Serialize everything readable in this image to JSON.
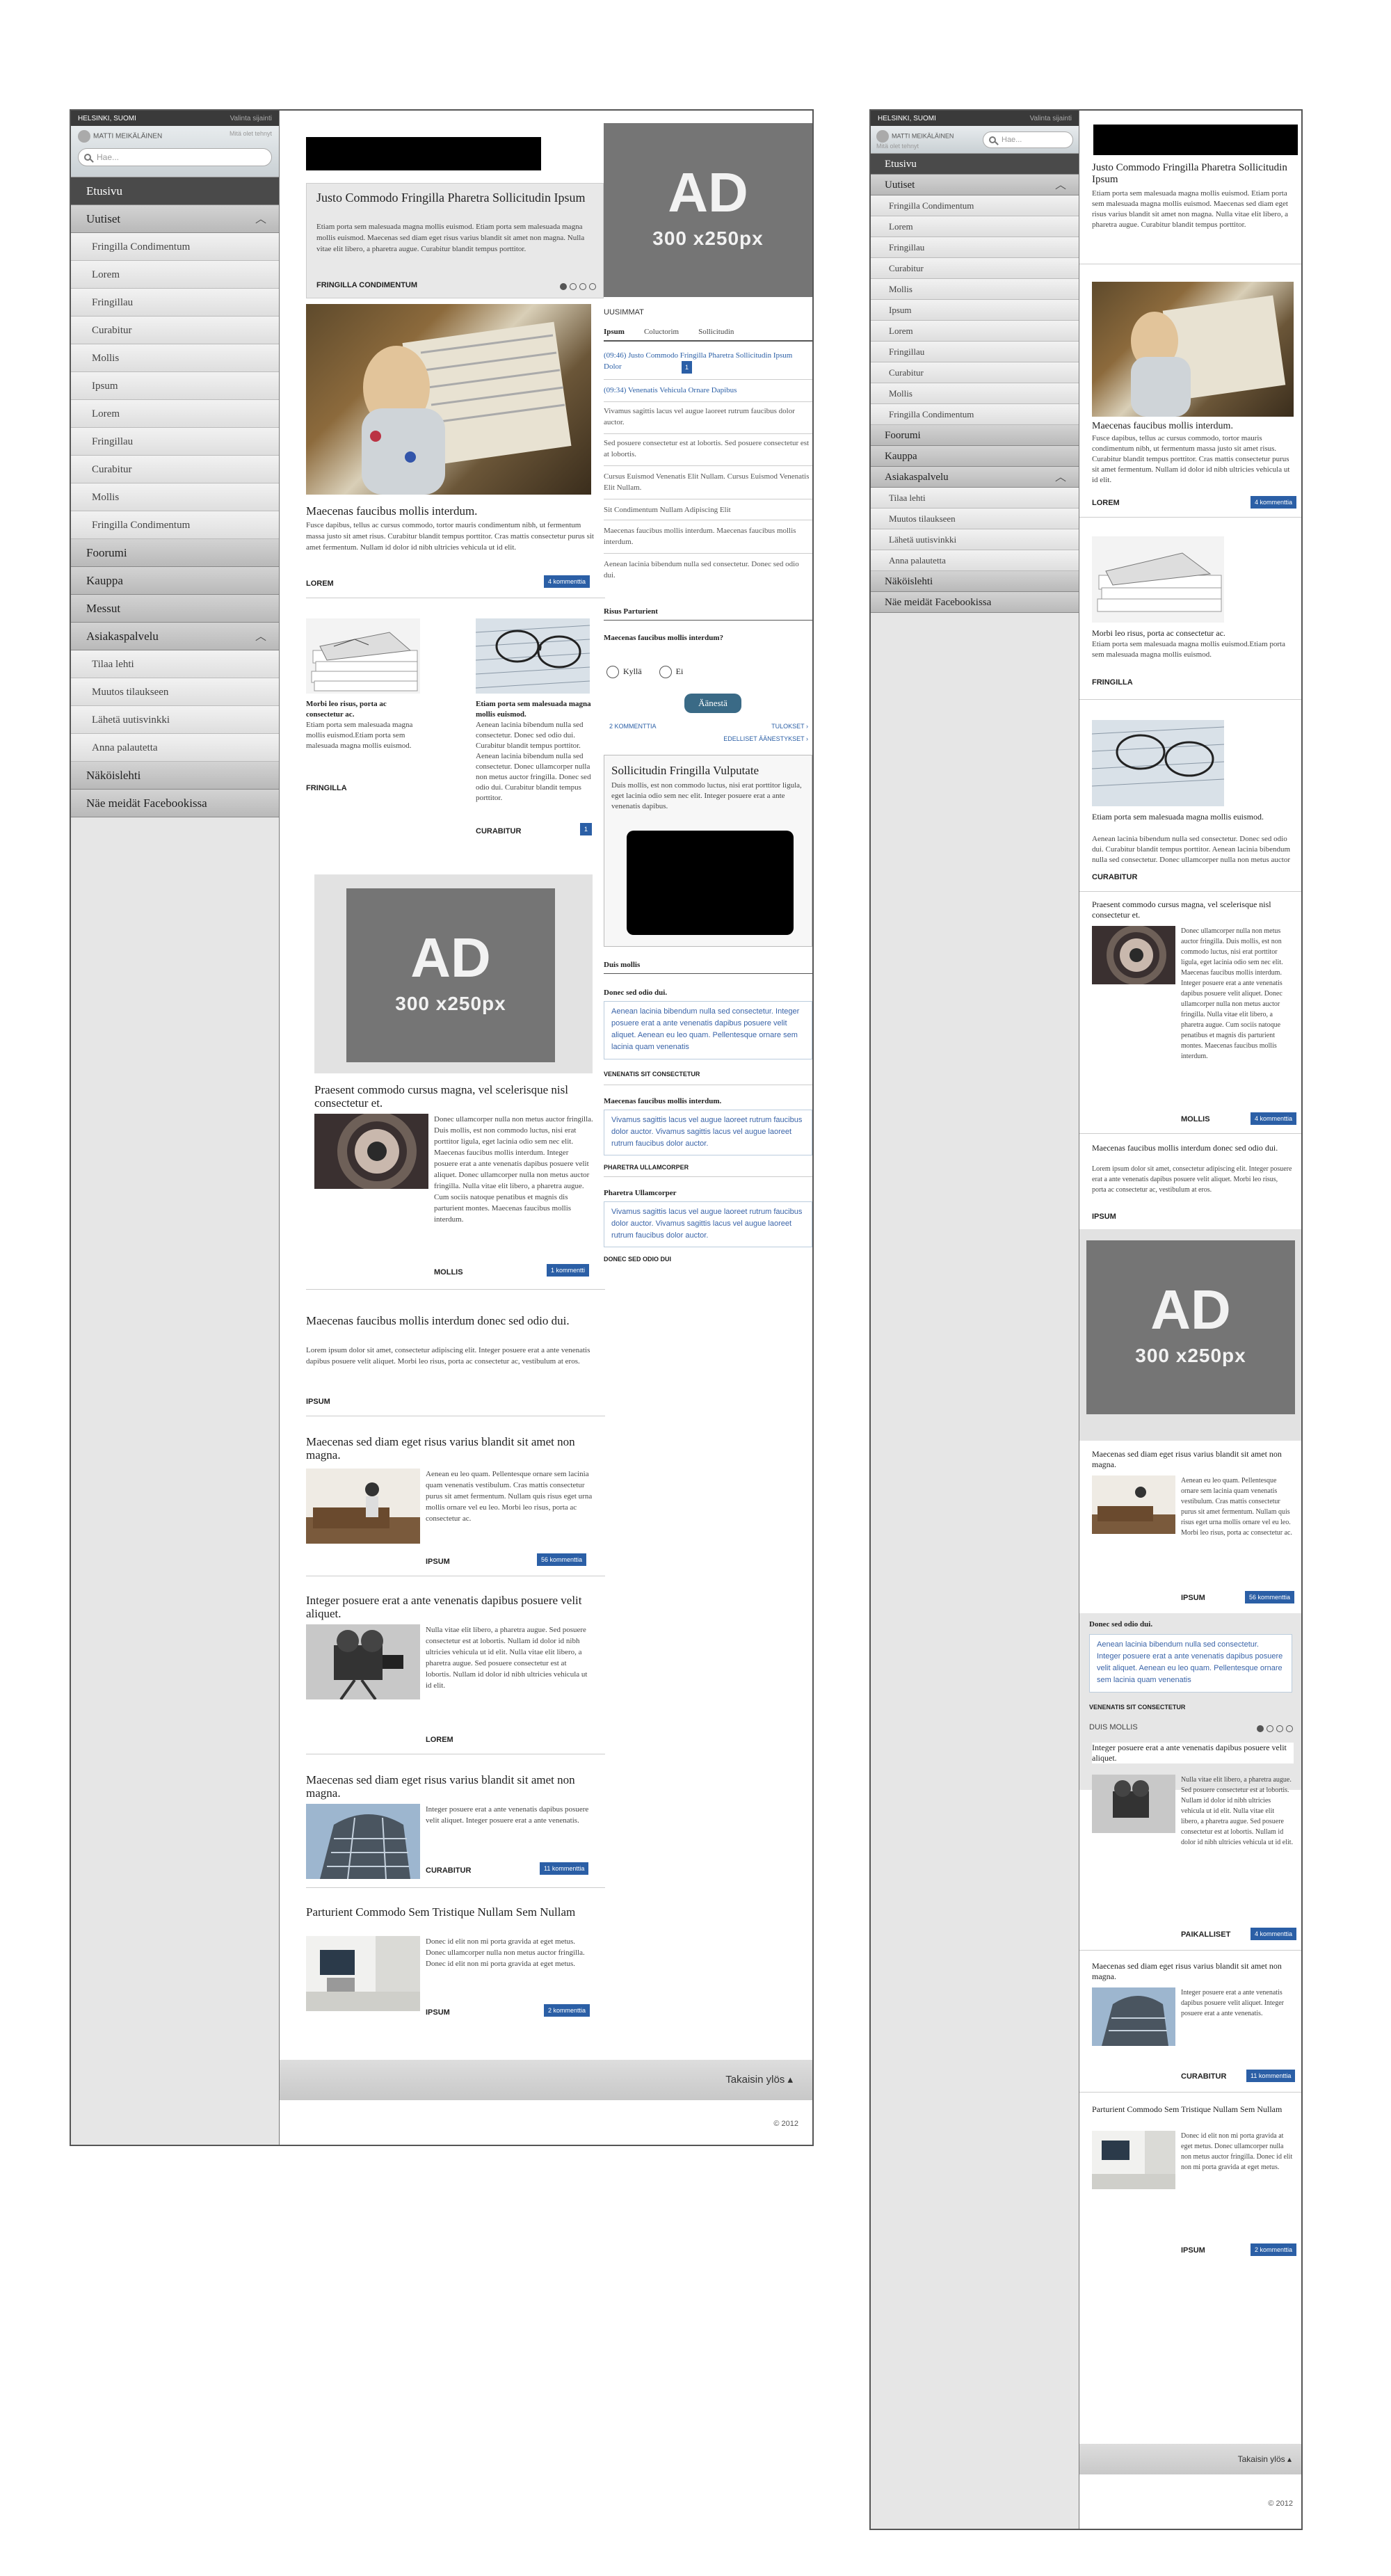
{
  "topbar": {
    "city": "HELSINKI, SUOMI",
    "logout": "Valinta sijainti"
  },
  "user": {
    "name": "MATTI MEIKÄLÄINEN",
    "meta": "Mitä olet tehnyt"
  },
  "search": {
    "placeholder": "Hae..."
  },
  "nav_a": {
    "home": "Etusivu",
    "news": "Uutiset",
    "news_items": [
      "Fringilla Condimentum",
      "Lorem",
      "Fringillau",
      "Curabitur",
      "Mollis",
      "Ipsum",
      "Lorem",
      "Fringillau",
      "Curabitur",
      "Mollis",
      "Fringilla Condimentum"
    ],
    "forum": "Foorumi",
    "shop": "Kauppa",
    "fairs": "Messut",
    "service": "Asiakaspalvelu",
    "service_items": [
      "Tilaa lehti",
      "Muutos tilaukseen",
      "Lähetä uutisvinkki",
      "Anna palautetta"
    ],
    "paper": "Näköislehti",
    "fb": "Näe meidät Facebookissa"
  },
  "nav_b": {
    "home": "Etusivu",
    "news": "Uutiset",
    "news_items": [
      "Fringilla Condimentum",
      "Lorem",
      "Fringillau",
      "Curabitur",
      "Mollis",
      "Ipsum",
      "Lorem",
      "Fringillau",
      "Curabitur",
      "Mollis",
      "Fringilla Condimentum"
    ],
    "forum": "Foorumi",
    "shop": "Kauppa",
    "service": "Asiakaspalvelu",
    "service_items": [
      "Tilaa lehti",
      "Muutos tilaukseen",
      "Lähetä uutisvinkki",
      "Anna palautetta"
    ],
    "paper": "Näköislehti",
    "fb": "Näe meidät Facebookissa"
  },
  "ad": {
    "big": "AD",
    "size": "300 x250px"
  },
  "feature": {
    "title": "Justo Commodo Fringilla Pharetra Sollicitudin Ipsum",
    "text": "Etiam porta sem malesuada magna mollis euismod. Etiam porta sem malesuada magna mollis euismod. Maecenas sed diam eget risus varius blandit sit amet non magna. Nulla vitae elit libero, a pharetra augue. Curabitur blandit tempus porttitor.",
    "category": "FRINGILLA CONDIMENTUM"
  },
  "article_main": {
    "title": "Maecenas faucibus mollis interdum.",
    "text": "Fusce dapibus, tellus ac cursus commodo, tortor mauris condimentum nibh, ut fermentum massa justo sit amet risus. Curabitur blandit tempus porttitor. Cras mattis consectetur purus sit amet fermentum. Nullam id dolor id nibh ultricies vehicula ut id elit.",
    "category": "LOREM",
    "comments": "4 kommenttia"
  },
  "article_left": {
    "title": "Morbi leo risus, porta ac consectetur ac.",
    "text": "Etiam porta sem malesuada magna mollis euismod.Etiam porta sem malesuada magna mollis euismod.",
    "category": "FRINGILLA"
  },
  "article_right": {
    "title": "Etiam porta sem malesuada magna mollis euismod.",
    "text": "Aenean lacinia bibendum nulla sed consectetur. Donec sed odio dui. Curabitur blandit tempus porttitor. Aenean lacinia bibendum nulla sed consectetur. Donec ullamcorper nulla non metus auctor fringilla. Donec sed odio dui. Curabitur blandit tempus porttitor.",
    "category": "CURABITUR",
    "comments": "1"
  },
  "article_eye": {
    "title": "Praesent commodo cursus magna, vel scelerisque nisl consectetur et.",
    "text": "Donec ullamcorper nulla non metus auctor fringilla. Duis mollis, est non commodo luctus, nisi erat porttitor ligula, eget lacinia odio sem nec elit. Maecenas faucibus mollis interdum. Integer posuere erat a ante venenatis dapibus posuere velit aliquet. Donec ullamcorper nulla non metus auctor fringilla. Nulla vitae elit libero, a pharetra augue. Cum sociis natoque penatibus et magnis dis parturient montes. Maecenas faucibus mollis interdum.",
    "category": "MOLLIS",
    "comments": "1 kommentti",
    "comments_b": "4 kommenttia"
  },
  "article_donec": {
    "title": "Maecenas faucibus mollis interdum donec sed odio dui.",
    "text": "Lorem ipsum dolor sit amet, consectetur adipiscing elit. Integer posuere erat a ante venenatis dapibus posuere velit aliquet. Morbi leo risus, porta ac consectetur ac, vestibulum at eros.",
    "category": "IPSUM"
  },
  "article_sofa": {
    "title": "Maecenas sed diam eget risus varius blandit sit amet non magna.",
    "text": "Aenean eu leo quam. Pellentesque ornare sem lacinia quam venenatis vestibulum. Cras mattis consectetur purus sit amet fermentum. Nullam quis risus eget urna mollis ornare vel eu leo. Morbi leo risus, porta ac consectetur ac.",
    "category": "IPSUM",
    "comments": "56 kommenttia"
  },
  "article_camera": {
    "title": "Integer posuere erat a ante venenatis dapibus posuere velit aliquet.",
    "text": "Nulla vitae elit libero, a pharetra augue. Sed posuere consectetur est at lobortis. Nullam id dolor id nibh ultricies vehicula ut id elit. Nulla vitae elit libero, a pharetra augue. Sed posuere consectetur est at lobortis. Nullam id dolor id nibh ultricies vehicula ut id elit.",
    "category": "LOREM",
    "category_b": "PAIKALLISET",
    "comments_b": "4 kommenttia"
  },
  "article_build": {
    "title": "Maecenas sed diam eget risus varius blandit sit amet non magna.",
    "text": "Integer posuere erat a ante venenatis dapibus posuere velit aliquet. Integer posuere erat a ante venenatis.",
    "category": "CURABITUR",
    "comments": "11 kommenttia"
  },
  "article_room": {
    "title": "Parturient Commodo Sem Tristique Nullam Sem Nullam",
    "text": "Donec id elit non mi porta gravida at eget metus. Donec ullamcorper nulla non metus auctor fringilla. Donec id elit non mi porta gravida at eget metus.",
    "category": "IPSUM",
    "comments": "2 kommenttia"
  },
  "latest": {
    "heading": "UUSIMMAT",
    "tabs": [
      "Ipsum",
      "Coluctorim",
      "Sollicitudin"
    ],
    "items": [
      "(09:46) Justo Commodo Fringilla Pharetra Sollicitudin Ipsum Dolor",
      "(09:34) Venenatis Vehicula Ornare Dapibus",
      "Vivamus sagittis lacus vel augue laoreet rutrum faucibus dolor auctor.",
      "Sed posuere consectetur est at lobortis. Sed posuere consectetur est at lobortis.",
      "Cursus Euismod Venenatis Elit Nullam. Cursus Euismod Venenatis Elit Nullam.",
      "Sit Condimentum Nullam Adipiscing Elit",
      "Maecenas faucibus mollis interdum. Maecenas faucibus mollis interdum.",
      "Aenean lacinia bibendum nulla sed consectetur. Donec sed odio dui."
    ],
    "badge": "1"
  },
  "poll": {
    "heading": "Risus Parturient",
    "question": "Maecenas faucibus mollis interdum?",
    "yes": "Kyllä",
    "no": "Ei",
    "vote": "Äänestä",
    "comments": "2 KOMMENTTIA",
    "results": "TULOKSET ›",
    "previous": "EDELLISET ÄÄNESTYKSET ›"
  },
  "video": {
    "title": "Sollicitudin Fringilla Vulputate",
    "text": "Duis mollis, est non commodo luctus, nisi erat porttitor ligula, eget lacinia odio sem nec elit. Integer posuere erat a ante venenatis dapibus."
  },
  "discussion": {
    "heading": "Duis mollis",
    "threads": [
      {
        "title": "Donec sed odio dui.",
        "quote": "Aenean lacinia bibendum nulla sed consectetur. Integer posuere erat a ante venenatis dapibus posuere velit aliquet. Aenean eu leo quam. Pellentesque ornare sem lacinia quam venenatis",
        "tag": "VENENATIS SIT CONSECTETUR"
      },
      {
        "title": "Maecenas faucibus mollis interdum.",
        "quote": "Vivamus sagittis lacus vel augue laoreet rutrum faucibus dolor auctor. Vivamus sagittis lacus vel augue laoreet rutrum faucibus dolor auctor.",
        "tag": "PHARETRA ULLAMCORPER"
      },
      {
        "title": "Pharetra Ullamcorper",
        "quote": "Vivamus sagittis lacus vel augue laoreet rutrum faucibus dolor auctor. Vivamus sagittis lacus vel augue laoreet rutrum faucibus dolor auctor.",
        "tag": "DONEC SED ODIO DUI"
      }
    ],
    "mobile_footer": "DUIS MOLLIS"
  },
  "footer": {
    "back_to_top": "Takaisin ylös ▴",
    "copyright": "© 2012"
  },
  "colors": {
    "accent": "#2b5fa6",
    "sidebar": "#e6e6e6",
    "ad_bg": "#757575",
    "topbar": "#3a3a3a"
  }
}
